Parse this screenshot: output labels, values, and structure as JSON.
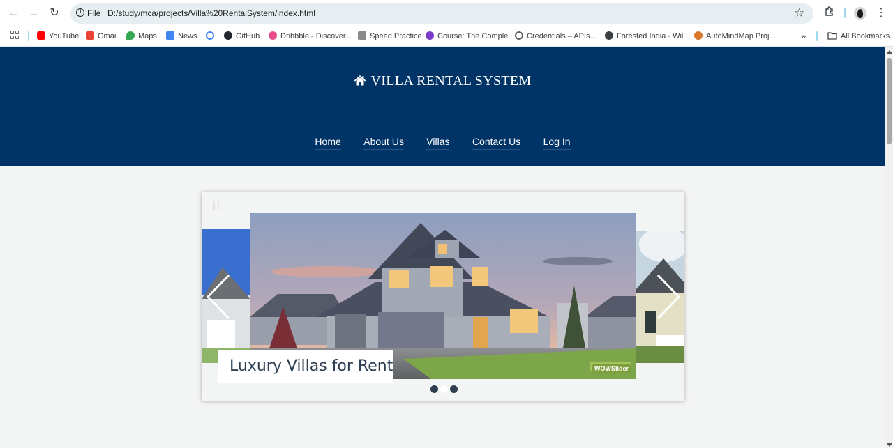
{
  "browser": {
    "omnibox": {
      "scheme_label": "File",
      "url": "D:/study/mca/projects/Villa%20RentalSystem/index.html"
    },
    "bookmarks": [
      {
        "label": "YouTube",
        "icon": "youtube-icon",
        "color": "#ff0000"
      },
      {
        "label": "Gmail",
        "icon": "gmail-icon",
        "color": "#ea4335"
      },
      {
        "label": "Maps",
        "icon": "maps-icon",
        "color": "#34a853"
      },
      {
        "label": "News",
        "icon": "news-icon",
        "color": "#4285f4"
      },
      {
        "label": "",
        "icon": "google-icon",
        "color": "#4285f4"
      },
      {
        "label": "GitHub",
        "icon": "github-icon",
        "color": "#24292f"
      },
      {
        "label": "Dribbble - Discover...",
        "icon": "dribbble-icon",
        "color": "#ea4c89"
      },
      {
        "label": "Speed Practice",
        "icon": "speed-practice-icon",
        "color": "#8a8a8a"
      },
      {
        "label": "Course: The Comple...",
        "icon": "course-icon",
        "color": "#7d3cc8"
      },
      {
        "label": "Credentials – APIs...",
        "icon": "credentials-icon",
        "color": "#5f6368"
      },
      {
        "label": "Forested India - Wil...",
        "icon": "globe-icon",
        "color": "#3c4043"
      },
      {
        "label": "AutoMindMap Proj...",
        "icon": "automindmap-icon",
        "color": "#d9772b"
      }
    ],
    "all_bookmarks_label": "All Bookmarks"
  },
  "site": {
    "brand": "VILLA RENTAL SYSTEM",
    "header_color": "#003366",
    "nav": [
      {
        "label": "Home"
      },
      {
        "label": "About Us"
      },
      {
        "label": "Villas"
      },
      {
        "label": "Contact Us"
      },
      {
        "label": "Log In"
      }
    ]
  },
  "slider": {
    "caption": "Luxury Villas for Rent",
    "watermark": "WOWSlider",
    "slide_count": 3,
    "active_slide": 2
  }
}
